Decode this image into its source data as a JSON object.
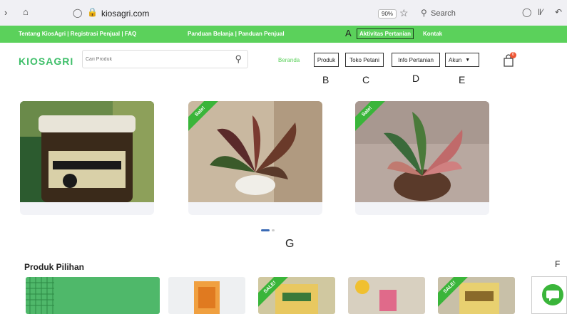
{
  "browser": {
    "url": "kiosagri.com",
    "zoom": "90%",
    "search_placeholder": "Search"
  },
  "topbar": {
    "left_links": "Tentang KiosAgri | Registrasi Penjual | FAQ",
    "guide_links": "Panduan Belanja | Panduan Penjual",
    "activity": "Aktivitas Pertanian",
    "contact": "Kontak"
  },
  "header": {
    "logo": "KIOSAGRI",
    "search_placeholder": "Cari Produk",
    "nav_home": "Beranda",
    "nav_products": "Produk",
    "nav_shop": "Toko Petani",
    "nav_info": "Info Pertanian",
    "nav_account": "Akun",
    "cart_count": "0"
  },
  "annotations": {
    "A": "A",
    "B": "B",
    "C": "C",
    "D": "D",
    "E": "E",
    "F": "F",
    "G": "G"
  },
  "slides": [
    {
      "label": "Black Garlic Kipass",
      "sale": false
    },
    {
      "label": "Aglonema plant",
      "sale": true,
      "sale_text": "Sale!"
    },
    {
      "label": "Aglonema plant pink",
      "sale": true,
      "sale_text": "Sale!"
    }
  ],
  "section": {
    "title": "Produk Pilihan"
  },
  "products": [
    {
      "sale": false
    },
    {
      "sale": false
    },
    {
      "sale": true,
      "sale_text": "SALE!"
    },
    {
      "sale": false
    },
    {
      "sale": true,
      "sale_text": "SALE!"
    }
  ],
  "colors": {
    "brand_green": "#5bd15b",
    "sale_green": "#3ab53a"
  }
}
